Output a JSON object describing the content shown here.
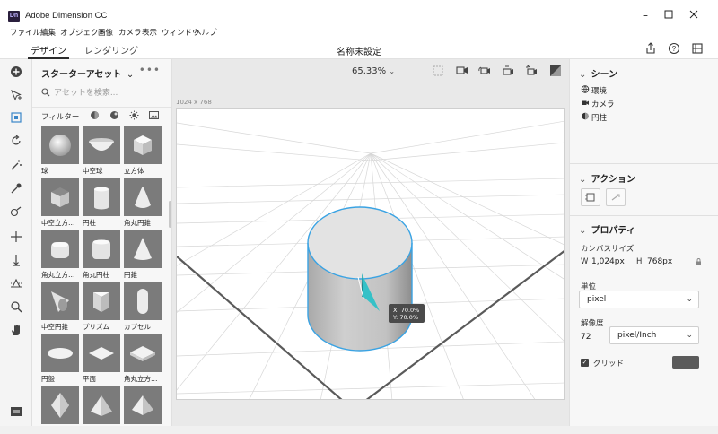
{
  "window": {
    "icon_text": "Dn",
    "title": "Adobe Dimension CC"
  },
  "menu": [
    "ファイル",
    "編集",
    "オブジェクト",
    "画像",
    "カメラ",
    "表示",
    "ウィンドウ",
    "ヘルプ"
  ],
  "header": {
    "tab_design": "デザイン",
    "tab_render": "レンダリング",
    "doc_title": "名称未設定"
  },
  "assets": {
    "title": "スターターアセット",
    "title_chevron": "⌄",
    "more": "•••",
    "search_placeholder": "アセットを検索...",
    "filter_label": "フィルター",
    "items": [
      {
        "label": "球",
        "shape": "sphere"
      },
      {
        "label": "中空球",
        "shape": "bowl"
      },
      {
        "label": "立方体",
        "shape": "cube"
      },
      {
        "label": "中空立方…",
        "shape": "hollow-cube"
      },
      {
        "label": "円柱",
        "shape": "cylinder"
      },
      {
        "label": "角丸円錐",
        "shape": "rounded-cone"
      },
      {
        "label": "角丸立方…",
        "shape": "rounded-cube"
      },
      {
        "label": "角丸円柱",
        "shape": "rounded-cylinder"
      },
      {
        "label": "円錐",
        "shape": "cone"
      },
      {
        "label": "中空円錐",
        "shape": "hollow-cone"
      },
      {
        "label": "プリズム",
        "shape": "prism"
      },
      {
        "label": "カプセル",
        "shape": "capsule"
      },
      {
        "label": "円盤",
        "shape": "disc"
      },
      {
        "label": "平面",
        "shape": "plane"
      },
      {
        "label": "角丸立方…",
        "shape": "rounded-slab"
      },
      {
        "label": "",
        "shape": "octahedron"
      },
      {
        "label": "",
        "shape": "pyramid"
      },
      {
        "label": "",
        "shape": "pyramid2"
      }
    ]
  },
  "canvas": {
    "zoom": "65.33%",
    "size_label": "1024 x 768",
    "tooltip_x": "X: 70.0%",
    "tooltip_y": "Y: 70.0%"
  },
  "right_panel": {
    "scene_title": "シーン",
    "scene_items": [
      "環境",
      "カメラ",
      "円柱"
    ],
    "actions_title": "アクション",
    "props_title": "プロパティ",
    "canvas_size_label": "カンバスサイズ",
    "width_label": "W",
    "width_value": "1,024px",
    "height_label": "H",
    "height_value": "768px",
    "unit_label": "単位",
    "unit_value": "pixel",
    "resolution_label": "解像度",
    "resolution_value": "72",
    "resolution_unit": "pixel/Inch",
    "grid_label": "グリッド",
    "grid_checked": true,
    "grid_color": "#5b5b5b"
  },
  "colors": {
    "accent": "#3aa3e3",
    "selection_teal": "#35c1c7"
  }
}
